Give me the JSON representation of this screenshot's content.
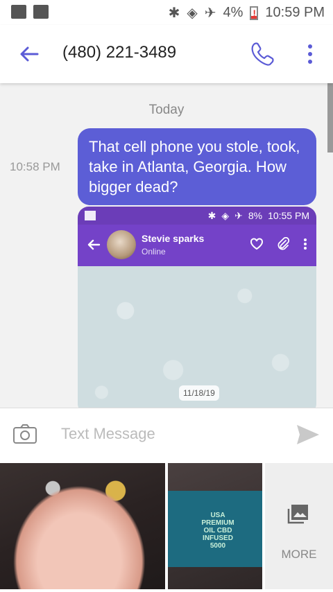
{
  "status_bar": {
    "battery": "4%",
    "time": "10:59 PM"
  },
  "header": {
    "title": "(480) 221-3489"
  },
  "conversation": {
    "date_divider": "Today",
    "message": {
      "time": "10:58 PM",
      "text": "That cell phone you stole, took, take in Atlanta, Georgia. How bigger dead?"
    },
    "attachment": {
      "battery": "8%",
      "time": "10:55 PM",
      "contact_name": "Stevie sparks",
      "contact_status": "Online",
      "date_chip": "11/18/19",
      "bottle_text": "USA PREMIUM OIL CBD INFUSED 5000"
    }
  },
  "composer": {
    "placeholder": "Text Message"
  },
  "gallery": {
    "more_label": "MORE",
    "bottle_label": "USA PREMIUM OIL CBD INFUSED 5000"
  },
  "colors": {
    "accent": "#5c5ed6",
    "telegram_bar": "#7442c8"
  }
}
